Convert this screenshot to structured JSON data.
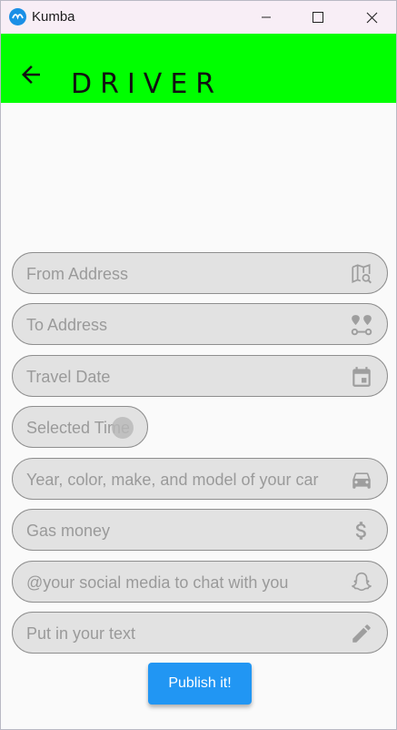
{
  "window": {
    "title": "Kumba"
  },
  "appbar": {
    "title": "DRIVER",
    "color": "#00ff00"
  },
  "form": {
    "fields": [
      {
        "placeholder": "From Address",
        "icon": "map-search-icon"
      },
      {
        "placeholder": "To Address",
        "icon": "route-icon"
      },
      {
        "placeholder": "Travel Date",
        "icon": "calendar-icon"
      },
      {
        "placeholder": "Selected Time",
        "icon": "clock-icon"
      },
      {
        "placeholder": "Year, color, make, and model of your car",
        "icon": "car-icon"
      },
      {
        "placeholder": "Gas money",
        "icon": "dollar-icon"
      },
      {
        "placeholder": "@your social media to chat with you",
        "icon": "snapchat-icon"
      },
      {
        "placeholder": "Put in your text",
        "icon": "pencil-icon"
      }
    ],
    "submit_label": "Publish it!",
    "accent": "#2196f3"
  }
}
